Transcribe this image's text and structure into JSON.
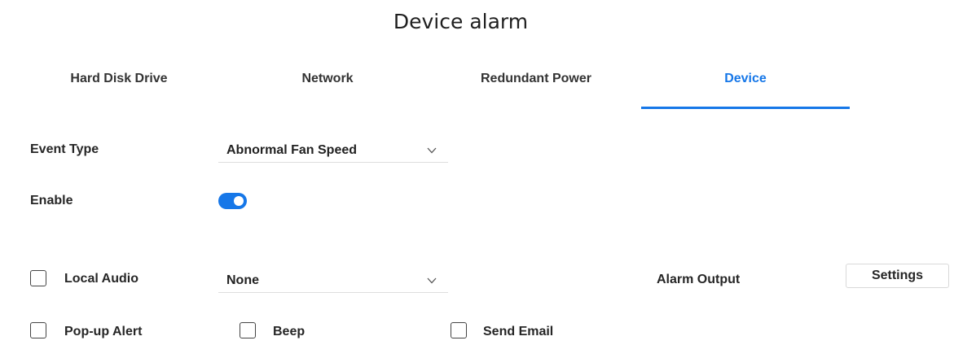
{
  "page_title": "Device alarm",
  "tabs": [
    {
      "label": "Hard Disk Drive",
      "active": false
    },
    {
      "label": "Network",
      "active": false
    },
    {
      "label": "Redundant Power",
      "active": false
    },
    {
      "label": "Device",
      "active": true
    }
  ],
  "event_type": {
    "label": "Event Type",
    "value": "Abnormal Fan Speed"
  },
  "enable": {
    "label": "Enable",
    "on": true
  },
  "local_audio": {
    "label": "Local Audio",
    "checked": false,
    "value": "None"
  },
  "alarm_output": {
    "label": "Alarm Output",
    "button_label": "Settings"
  },
  "popup_alert": {
    "label": "Pop-up Alert",
    "checked": false
  },
  "beep": {
    "label": "Beep",
    "checked": false
  },
  "send_email": {
    "label": "Send Email",
    "checked": false
  },
  "colors": {
    "accent": "#1677e8"
  },
  "icons": {
    "dropdown": "chevron-down-icon"
  }
}
